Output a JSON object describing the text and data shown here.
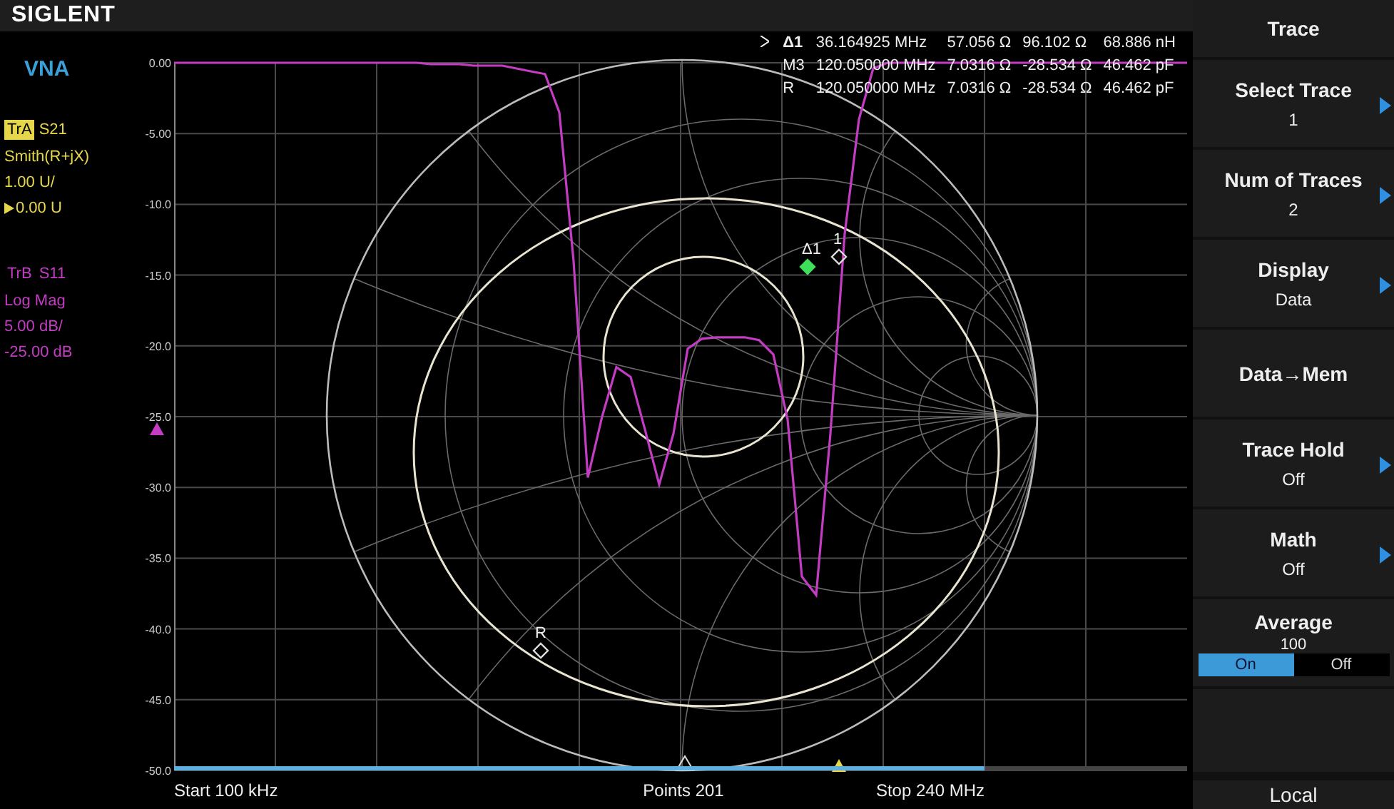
{
  "brand": "SIGLENT",
  "mode": "VNA",
  "traces": [
    {
      "tag": "TrA",
      "param": "S21",
      "format": "Smith(R+jX)",
      "scale": "1.00 U/",
      "reference": "0.00 U",
      "color": "#e6d64a",
      "selected": true
    },
    {
      "tag": "TrB",
      "param": "S11",
      "format": "Log Mag",
      "scale": "5.00 dB/",
      "reference": "-25.00 dB",
      "color": "#c43cc4",
      "selected": false
    }
  ],
  "log_mag_chart": {
    "chart_data": {
      "type": "line",
      "ylim": [
        -50,
        0
      ],
      "grid": true,
      "yticks": [
        {
          "value": 0,
          "label": "0.00"
        },
        {
          "value": -5,
          "label": "-5.00"
        },
        {
          "value": -10,
          "label": "-10.0"
        },
        {
          "value": -15,
          "label": "-15.0"
        },
        {
          "value": -20,
          "label": "-20.0"
        },
        {
          "value": -25,
          "label": "-25.0"
        },
        {
          "value": -30,
          "label": "-30.0"
        },
        {
          "value": -35,
          "label": "-35.0"
        },
        {
          "value": -40,
          "label": "-40.0"
        },
        {
          "value": -45,
          "label": "-45.0"
        },
        {
          "value": -50,
          "label": "-50.0"
        }
      ],
      "categories": [
        null,
        null,
        null,
        null,
        null,
        null,
        null,
        null,
        null,
        null,
        null,
        null,
        null,
        null,
        null,
        null,
        null,
        null,
        null,
        null,
        null,
        null,
        null,
        null,
        null,
        null,
        null,
        null,
        null,
        null,
        null,
        null,
        null,
        null,
        null,
        null,
        null,
        null,
        null,
        null,
        null,
        null,
        null,
        null,
        null,
        null,
        null,
        null,
        null,
        null,
        null,
        null,
        null,
        null,
        null,
        null,
        null,
        null,
        null,
        null,
        null,
        null,
        null,
        null,
        null,
        null,
        null,
        null,
        null,
        null,
        null,
        null
      ],
      "series": [
        {
          "color": "#c43cc4",
          "values": [
            0,
            0,
            0,
            0,
            0,
            0,
            0,
            0,
            0,
            0,
            0,
            0,
            0,
            0,
            0,
            0,
            0,
            0,
            -0.1,
            -0.1,
            -0.1,
            -0.2,
            -0.2,
            -0.2,
            -0.4,
            -0.6,
            -0.8,
            -3.5,
            -14,
            -29.3,
            -25,
            -21.5,
            -22.2,
            -25.9,
            -29.8,
            -26.2,
            -20.2,
            -19.5,
            -19.4,
            -19.4,
            -19.4,
            -19.6,
            -20.6,
            -25.2,
            -36.3,
            -37.6,
            -26.2,
            -12.1,
            -4,
            -0.4,
            0,
            0,
            0,
            0,
            0,
            0,
            0,
            0,
            0,
            0,
            0,
            0,
            0,
            0,
            0,
            0,
            0,
            0,
            0,
            0,
            0,
            0
          ]
        }
      ]
    }
  },
  "sweep": {
    "level": 0.8
  },
  "marker_table": [
    {
      "label": "Δ1",
      "frequency": "36.164925 MHz",
      "resistance": "57.056 Ω",
      "reactance": "96.102 Ω",
      "lc": "68.886 nH",
      "selected": true
    },
    {
      "label": "M3",
      "frequency": "120.050000 MHz",
      "resistance": "7.0316 Ω",
      "reactance": "-28.534 Ω",
      "lc": "46.462 pF",
      "selected": false
    },
    {
      "label": "R",
      "frequency": "120.050000 MHz",
      "resistance": "7.0316 Ω",
      "reactance": "-28.534 Ω",
      "lc": "46.462 pF",
      "selected": false
    }
  ],
  "chart_markers": [
    {
      "label": "Δ1",
      "kind": "delta"
    },
    {
      "label": "1",
      "kind": "normal"
    },
    {
      "label": "R",
      "kind": "reference"
    }
  ],
  "footer": {
    "start": "Start 100 kHz",
    "points": "Points 201",
    "stop": "Stop 240 MHz"
  },
  "menu": {
    "title": "Trace",
    "items": [
      {
        "kind": "submenu",
        "label": "Select Trace",
        "value": "1"
      },
      {
        "kind": "submenu",
        "label": "Num of Traces",
        "value": "2"
      },
      {
        "kind": "submenu",
        "label": "Display",
        "value": "Data"
      },
      {
        "kind": "action",
        "label": "Data→Mem"
      },
      {
        "kind": "submenu",
        "label": "Trace Hold",
        "value": "Off"
      },
      {
        "kind": "submenu",
        "label": "Math",
        "value": "Off"
      },
      {
        "kind": "toggle",
        "label": "Average",
        "value": "100",
        "options": [
          {
            "label": "On",
            "selected": true
          },
          {
            "label": "Off",
            "selected": false
          }
        ]
      },
      {
        "kind": "blank"
      }
    ],
    "footer": "Local"
  }
}
